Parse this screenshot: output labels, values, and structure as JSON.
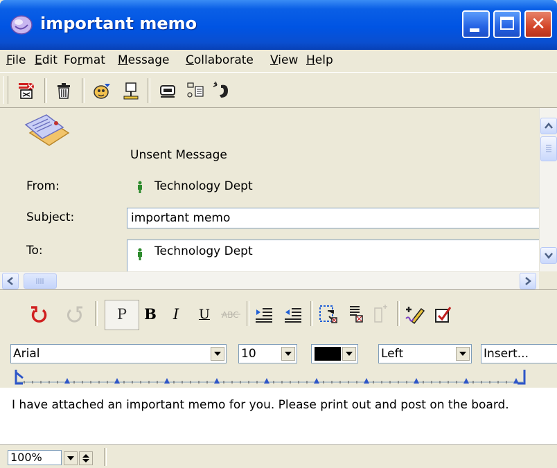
{
  "window": {
    "title": "important memo",
    "app_icon": "groupwise-icon"
  },
  "menubar": {
    "items": [
      {
        "label": "File",
        "u": "F",
        "rest": "ile"
      },
      {
        "label": "Edit",
        "u": "E",
        "rest": "dit"
      },
      {
        "label": "Format",
        "pre": "Fo",
        "u": "r",
        "rest": "mat"
      },
      {
        "label": "Message",
        "u": "M",
        "rest": "essage"
      },
      {
        "label": "Collaborate",
        "u": "C",
        "rest": "ollaborate"
      },
      {
        "label": "View",
        "u": "V",
        "rest": "iew"
      },
      {
        "label": "Help",
        "u": "H",
        "rest": "elp"
      }
    ]
  },
  "toolbar": {
    "icons": [
      "send-icon",
      "delete-icon",
      "address-book-icon",
      "signature-icon",
      "attach-icon",
      "insert-object-icon",
      "phone-icon"
    ]
  },
  "header": {
    "status": "Unsent Message",
    "from_label": "From:",
    "from_value": "Technology Dept",
    "subject_label": "Subject:",
    "subject_value": "important memo",
    "to_label": "To:",
    "to_value": "Technology Dept"
  },
  "format_toolbar": {
    "plain_label": "P",
    "bold_label": "B",
    "italic_label": "I",
    "underline_label": "U"
  },
  "formatting": {
    "font": "Arial",
    "size": "10",
    "color": "#000000",
    "alignment": "Left",
    "insert": "Insert..."
  },
  "message": {
    "body": "I have attached an important memo for you.  Please print out and post on the board."
  },
  "statusbar": {
    "zoom": "100%"
  }
}
